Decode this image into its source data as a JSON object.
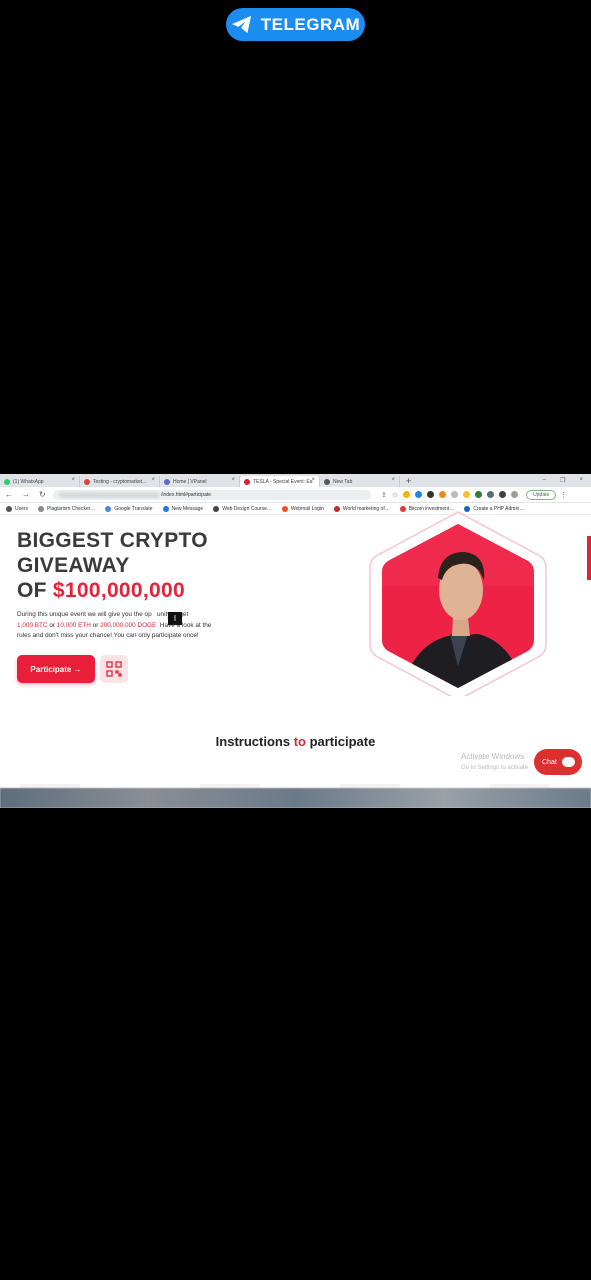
{
  "overlay": {
    "telegram_label": "TELEGRAM"
  },
  "browser": {
    "tabs": [
      {
        "label": "(1) WhatsApp",
        "color": "#25d366"
      },
      {
        "label": "Testing - cryptomarket…",
        "color": "#e34133"
      },
      {
        "label": "Home | VPanel",
        "color": "#5b6ad0"
      },
      {
        "label": "TESLA - Special Event: Ea",
        "color": "#e31937",
        "active": true
      },
      {
        "label": "New Tab",
        "color": "#555555"
      }
    ],
    "new_tab_glyph": "+",
    "url_path": "/index.html#participate",
    "update_label": "Update",
    "bookmarks": [
      {
        "label": "Users",
        "color": "#555555"
      },
      {
        "label": "Plagiarism Checker…",
        "color": "#888888"
      },
      {
        "label": "Google Translate",
        "color": "#4285f4"
      },
      {
        "label": "New Message",
        "color": "#1877f2"
      },
      {
        "label": "Web Design Course…",
        "color": "#444444"
      },
      {
        "label": "Webmail Login",
        "color": "#f4511e"
      },
      {
        "label": "World marketing of…",
        "color": "#c62828"
      },
      {
        "label": "Bitcoin investment…",
        "color": "#e53935"
      },
      {
        "label": "Create a PHP Admin…",
        "color": "#1565c0"
      }
    ]
  },
  "hero": {
    "line1": "BIGGEST CRYPTO",
    "line2": "GIVEAWAY",
    "line3_prefix": "OF ",
    "amount": "$100,000,000",
    "desc_a": "During this unique event we will give you the op",
    "desc_b": "unity to get",
    "btc": "1,000 BTC",
    "or1": " or ",
    "eth": "10,000 ETH",
    "or2": " or ",
    "doge": "200,000,000 DOGE",
    "desc_c": "Have a look at the",
    "desc_d": "rules and don't miss your chance! You can only participate once!",
    "participate_label": "Participate →"
  },
  "instructions": {
    "prefix": "Instructions ",
    "accent": "to",
    "suffix": " participate"
  },
  "windows_watermark": {
    "title": "Activate Windows",
    "sub": "Go to Settings to activate"
  },
  "chat_label": "Chat",
  "colors": {
    "accent": "#e3233a",
    "telegram": "#1c8df0",
    "button": "#e91e3a"
  }
}
